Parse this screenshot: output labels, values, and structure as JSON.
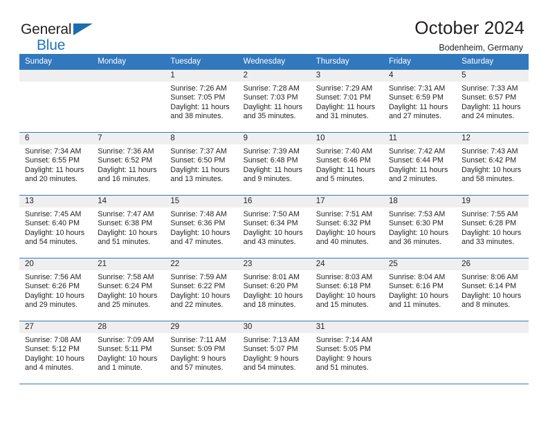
{
  "brand": {
    "line1": "General",
    "line2": "Blue",
    "triangle_icon": "blue-triangle-logo-mark"
  },
  "header": {
    "title": "October 2024",
    "subtitle": "Bodenheim, Germany"
  },
  "colors": {
    "header_blue": "#3278bd",
    "brand_blue": "#1b75bc",
    "daynum_band": "#efefef",
    "text": "#231f20"
  },
  "weekday_headers": [
    "Sunday",
    "Monday",
    "Tuesday",
    "Wednesday",
    "Thursday",
    "Friday",
    "Saturday"
  ],
  "labels": {
    "sunrise_prefix": "Sunrise:",
    "sunset_prefix": "Sunset:",
    "daylight_prefix": "Daylight:"
  },
  "weeks": [
    [
      {
        "day": ""
      },
      {
        "day": ""
      },
      {
        "day": "1",
        "sunrise": "Sunrise: 7:26 AM",
        "sunset": "Sunset: 7:05 PM",
        "daylight_l1": "Daylight: 11 hours",
        "daylight_l2": "and 38 minutes."
      },
      {
        "day": "2",
        "sunrise": "Sunrise: 7:28 AM",
        "sunset": "Sunset: 7:03 PM",
        "daylight_l1": "Daylight: 11 hours",
        "daylight_l2": "and 35 minutes."
      },
      {
        "day": "3",
        "sunrise": "Sunrise: 7:29 AM",
        "sunset": "Sunset: 7:01 PM",
        "daylight_l1": "Daylight: 11 hours",
        "daylight_l2": "and 31 minutes."
      },
      {
        "day": "4",
        "sunrise": "Sunrise: 7:31 AM",
        "sunset": "Sunset: 6:59 PM",
        "daylight_l1": "Daylight: 11 hours",
        "daylight_l2": "and 27 minutes."
      },
      {
        "day": "5",
        "sunrise": "Sunrise: 7:33 AM",
        "sunset": "Sunset: 6:57 PM",
        "daylight_l1": "Daylight: 11 hours",
        "daylight_l2": "and 24 minutes."
      }
    ],
    [
      {
        "day": "6",
        "sunrise": "Sunrise: 7:34 AM",
        "sunset": "Sunset: 6:55 PM",
        "daylight_l1": "Daylight: 11 hours",
        "daylight_l2": "and 20 minutes."
      },
      {
        "day": "7",
        "sunrise": "Sunrise: 7:36 AM",
        "sunset": "Sunset: 6:52 PM",
        "daylight_l1": "Daylight: 11 hours",
        "daylight_l2": "and 16 minutes."
      },
      {
        "day": "8",
        "sunrise": "Sunrise: 7:37 AM",
        "sunset": "Sunset: 6:50 PM",
        "daylight_l1": "Daylight: 11 hours",
        "daylight_l2": "and 13 minutes."
      },
      {
        "day": "9",
        "sunrise": "Sunrise: 7:39 AM",
        "sunset": "Sunset: 6:48 PM",
        "daylight_l1": "Daylight: 11 hours",
        "daylight_l2": "and 9 minutes."
      },
      {
        "day": "10",
        "sunrise": "Sunrise: 7:40 AM",
        "sunset": "Sunset: 6:46 PM",
        "daylight_l1": "Daylight: 11 hours",
        "daylight_l2": "and 5 minutes."
      },
      {
        "day": "11",
        "sunrise": "Sunrise: 7:42 AM",
        "sunset": "Sunset: 6:44 PM",
        "daylight_l1": "Daylight: 11 hours",
        "daylight_l2": "and 2 minutes."
      },
      {
        "day": "12",
        "sunrise": "Sunrise: 7:43 AM",
        "sunset": "Sunset: 6:42 PM",
        "daylight_l1": "Daylight: 10 hours",
        "daylight_l2": "and 58 minutes."
      }
    ],
    [
      {
        "day": "13",
        "sunrise": "Sunrise: 7:45 AM",
        "sunset": "Sunset: 6:40 PM",
        "daylight_l1": "Daylight: 10 hours",
        "daylight_l2": "and 54 minutes."
      },
      {
        "day": "14",
        "sunrise": "Sunrise: 7:47 AM",
        "sunset": "Sunset: 6:38 PM",
        "daylight_l1": "Daylight: 10 hours",
        "daylight_l2": "and 51 minutes."
      },
      {
        "day": "15",
        "sunrise": "Sunrise: 7:48 AM",
        "sunset": "Sunset: 6:36 PM",
        "daylight_l1": "Daylight: 10 hours",
        "daylight_l2": "and 47 minutes."
      },
      {
        "day": "16",
        "sunrise": "Sunrise: 7:50 AM",
        "sunset": "Sunset: 6:34 PM",
        "daylight_l1": "Daylight: 10 hours",
        "daylight_l2": "and 43 minutes."
      },
      {
        "day": "17",
        "sunrise": "Sunrise: 7:51 AM",
        "sunset": "Sunset: 6:32 PM",
        "daylight_l1": "Daylight: 10 hours",
        "daylight_l2": "and 40 minutes."
      },
      {
        "day": "18",
        "sunrise": "Sunrise: 7:53 AM",
        "sunset": "Sunset: 6:30 PM",
        "daylight_l1": "Daylight: 10 hours",
        "daylight_l2": "and 36 minutes."
      },
      {
        "day": "19",
        "sunrise": "Sunrise: 7:55 AM",
        "sunset": "Sunset: 6:28 PM",
        "daylight_l1": "Daylight: 10 hours",
        "daylight_l2": "and 33 minutes."
      }
    ],
    [
      {
        "day": "20",
        "sunrise": "Sunrise: 7:56 AM",
        "sunset": "Sunset: 6:26 PM",
        "daylight_l1": "Daylight: 10 hours",
        "daylight_l2": "and 29 minutes."
      },
      {
        "day": "21",
        "sunrise": "Sunrise: 7:58 AM",
        "sunset": "Sunset: 6:24 PM",
        "daylight_l1": "Daylight: 10 hours",
        "daylight_l2": "and 25 minutes."
      },
      {
        "day": "22",
        "sunrise": "Sunrise: 7:59 AM",
        "sunset": "Sunset: 6:22 PM",
        "daylight_l1": "Daylight: 10 hours",
        "daylight_l2": "and 22 minutes."
      },
      {
        "day": "23",
        "sunrise": "Sunrise: 8:01 AM",
        "sunset": "Sunset: 6:20 PM",
        "daylight_l1": "Daylight: 10 hours",
        "daylight_l2": "and 18 minutes."
      },
      {
        "day": "24",
        "sunrise": "Sunrise: 8:03 AM",
        "sunset": "Sunset: 6:18 PM",
        "daylight_l1": "Daylight: 10 hours",
        "daylight_l2": "and 15 minutes."
      },
      {
        "day": "25",
        "sunrise": "Sunrise: 8:04 AM",
        "sunset": "Sunset: 6:16 PM",
        "daylight_l1": "Daylight: 10 hours",
        "daylight_l2": "and 11 minutes."
      },
      {
        "day": "26",
        "sunrise": "Sunrise: 8:06 AM",
        "sunset": "Sunset: 6:14 PM",
        "daylight_l1": "Daylight: 10 hours",
        "daylight_l2": "and 8 minutes."
      }
    ],
    [
      {
        "day": "27",
        "sunrise": "Sunrise: 7:08 AM",
        "sunset": "Sunset: 5:12 PM",
        "daylight_l1": "Daylight: 10 hours",
        "daylight_l2": "and 4 minutes."
      },
      {
        "day": "28",
        "sunrise": "Sunrise: 7:09 AM",
        "sunset": "Sunset: 5:11 PM",
        "daylight_l1": "Daylight: 10 hours",
        "daylight_l2": "and 1 minute."
      },
      {
        "day": "29",
        "sunrise": "Sunrise: 7:11 AM",
        "sunset": "Sunset: 5:09 PM",
        "daylight_l1": "Daylight: 9 hours",
        "daylight_l2": "and 57 minutes."
      },
      {
        "day": "30",
        "sunrise": "Sunrise: 7:13 AM",
        "sunset": "Sunset: 5:07 PM",
        "daylight_l1": "Daylight: 9 hours",
        "daylight_l2": "and 54 minutes."
      },
      {
        "day": "31",
        "sunrise": "Sunrise: 7:14 AM",
        "sunset": "Sunset: 5:05 PM",
        "daylight_l1": "Daylight: 9 hours",
        "daylight_l2": "and 51 minutes."
      },
      {
        "day": ""
      },
      {
        "day": ""
      }
    ]
  ]
}
